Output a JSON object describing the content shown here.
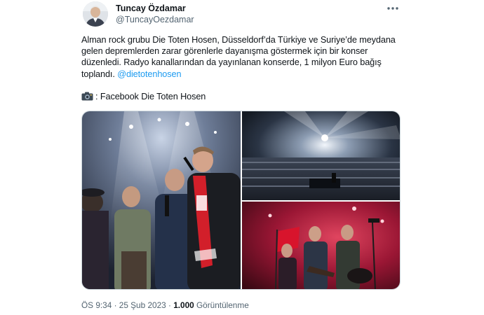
{
  "author": {
    "display_name": "Tuncay Özdamar",
    "handle": "@TuncayOezdamar"
  },
  "tweet": {
    "text_main": "Alman rock grubu Die Toten Hosen, Düsseldorf’da Türkiye ve Suriye’de meydana gelen depremlerden zarar görenlerle dayanışma göstermek için bir konser düzenledi. Radyo kanallarından da yayınlanan konserde, 1 milyon Euro bağış toplandı.",
    "mention": "@dietotenhosen",
    "credit": ": Facebook Die Toten Hosen"
  },
  "meta": {
    "time": "ÖS 9:34",
    "separator": " · ",
    "date": "25 Şub 2023",
    "views_count": "1.000",
    "views_label": "Görüntülenme"
  },
  "colors": {
    "accent": "#1d9bf0",
    "text": "#0f1419",
    "secondary": "#536471",
    "border": "#cfd9de"
  },
  "icons": {
    "more": "more-horizontal-icon",
    "credit": "camera-icon"
  }
}
